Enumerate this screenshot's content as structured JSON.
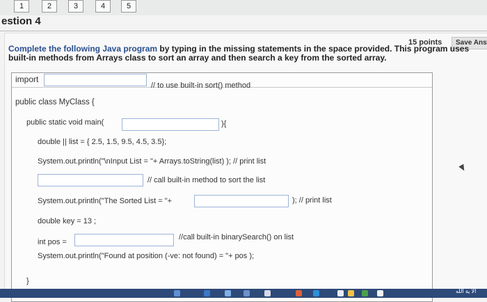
{
  "nav": {
    "items": [
      "1",
      "2",
      "3",
      "4",
      "5"
    ]
  },
  "question": {
    "title": "estion 4",
    "points": "15 points",
    "save_label": "Save Answer",
    "instruction_bold": "Complete the following Java program",
    "instruction_rest": " by typing in the missing statements in the space provided. This program uses built-in methods from Arrays class to sort an array and then search a key from the sorted array."
  },
  "code": {
    "import_label": "import",
    "import_comment": "// to use built-in sort() method",
    "class_decl": "public class MyClass {",
    "main_prefix": "public static void main(",
    "main_suffix": "){",
    "list_decl": "double || list = { 2.5, 1.5, 9.5, 4.5, 3.5};",
    "print_input": "System.out.println(\"\\nInput List = \"+ Arrays.toString(list) ); // print list",
    "sort_comment": "// call built-in method to sort the list",
    "print_sorted_prefix": "System.out.println(\"The Sorted List = \"+",
    "print_sorted_suffix": "); // print list",
    "key_decl": "double key = 13 ;",
    "pos_prefix": "int pos =",
    "pos_comment": "//call built-in binarySearch() on list",
    "print_found": "System.out.println(\"Found at position (-ve: not found) = \"+ pos );",
    "close_brace": "}"
  },
  "inputs": {
    "import_value": "",
    "main_param_value": "",
    "sort_value": "",
    "sorted_value": "",
    "pos_value": ""
  },
  "taskbar": {
    "text": "الأ ية الله"
  }
}
